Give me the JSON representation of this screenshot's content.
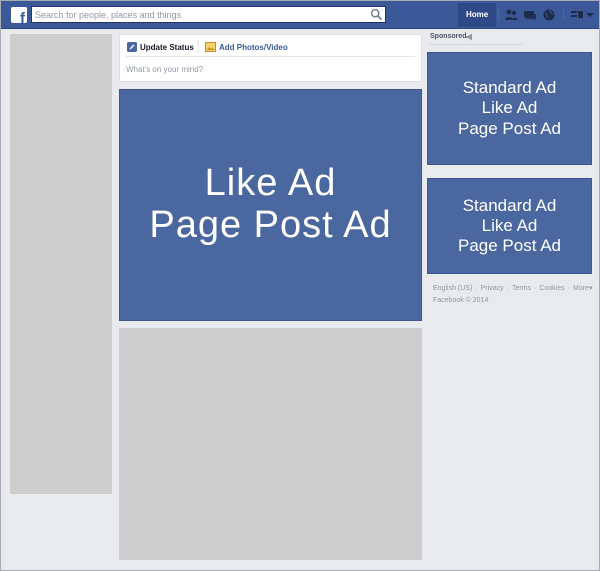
{
  "header": {
    "search_placeholder": "Search for people, places and things",
    "home_label": "Home",
    "icons": [
      "facebook-logo",
      "search-icon",
      "friend-requests-icon",
      "messages-icon",
      "notifications-icon",
      "privacy-shortcuts-icon",
      "settings-icon"
    ]
  },
  "composer": {
    "update_status_label": "Update Status",
    "add_photos_label": "Add Photos/Video",
    "input_placeholder": "What's on your mind?"
  },
  "main_ad": {
    "line1": "Like Ad",
    "line2": "Page Post Ad"
  },
  "sidebar": {
    "sponsored_label": "Sponsored",
    "ads": [
      {
        "line1": "Standard Ad",
        "line2": "Like Ad",
        "line3": "Page Post Ad"
      },
      {
        "line1": "Standard Ad",
        "line2": "Like Ad",
        "line3": "Page Post Ad"
      }
    ]
  },
  "footer": {
    "links": [
      "English (US)",
      "Privacy",
      "Terms",
      "Cookies",
      "More"
    ],
    "copyright": "Facebook © 2014"
  },
  "colors": {
    "brand_blue": "#3b5998",
    "ad_blue": "#4b67a0",
    "placeholder_gray": "#cccccc",
    "page_bg": "#e9eaed"
  }
}
